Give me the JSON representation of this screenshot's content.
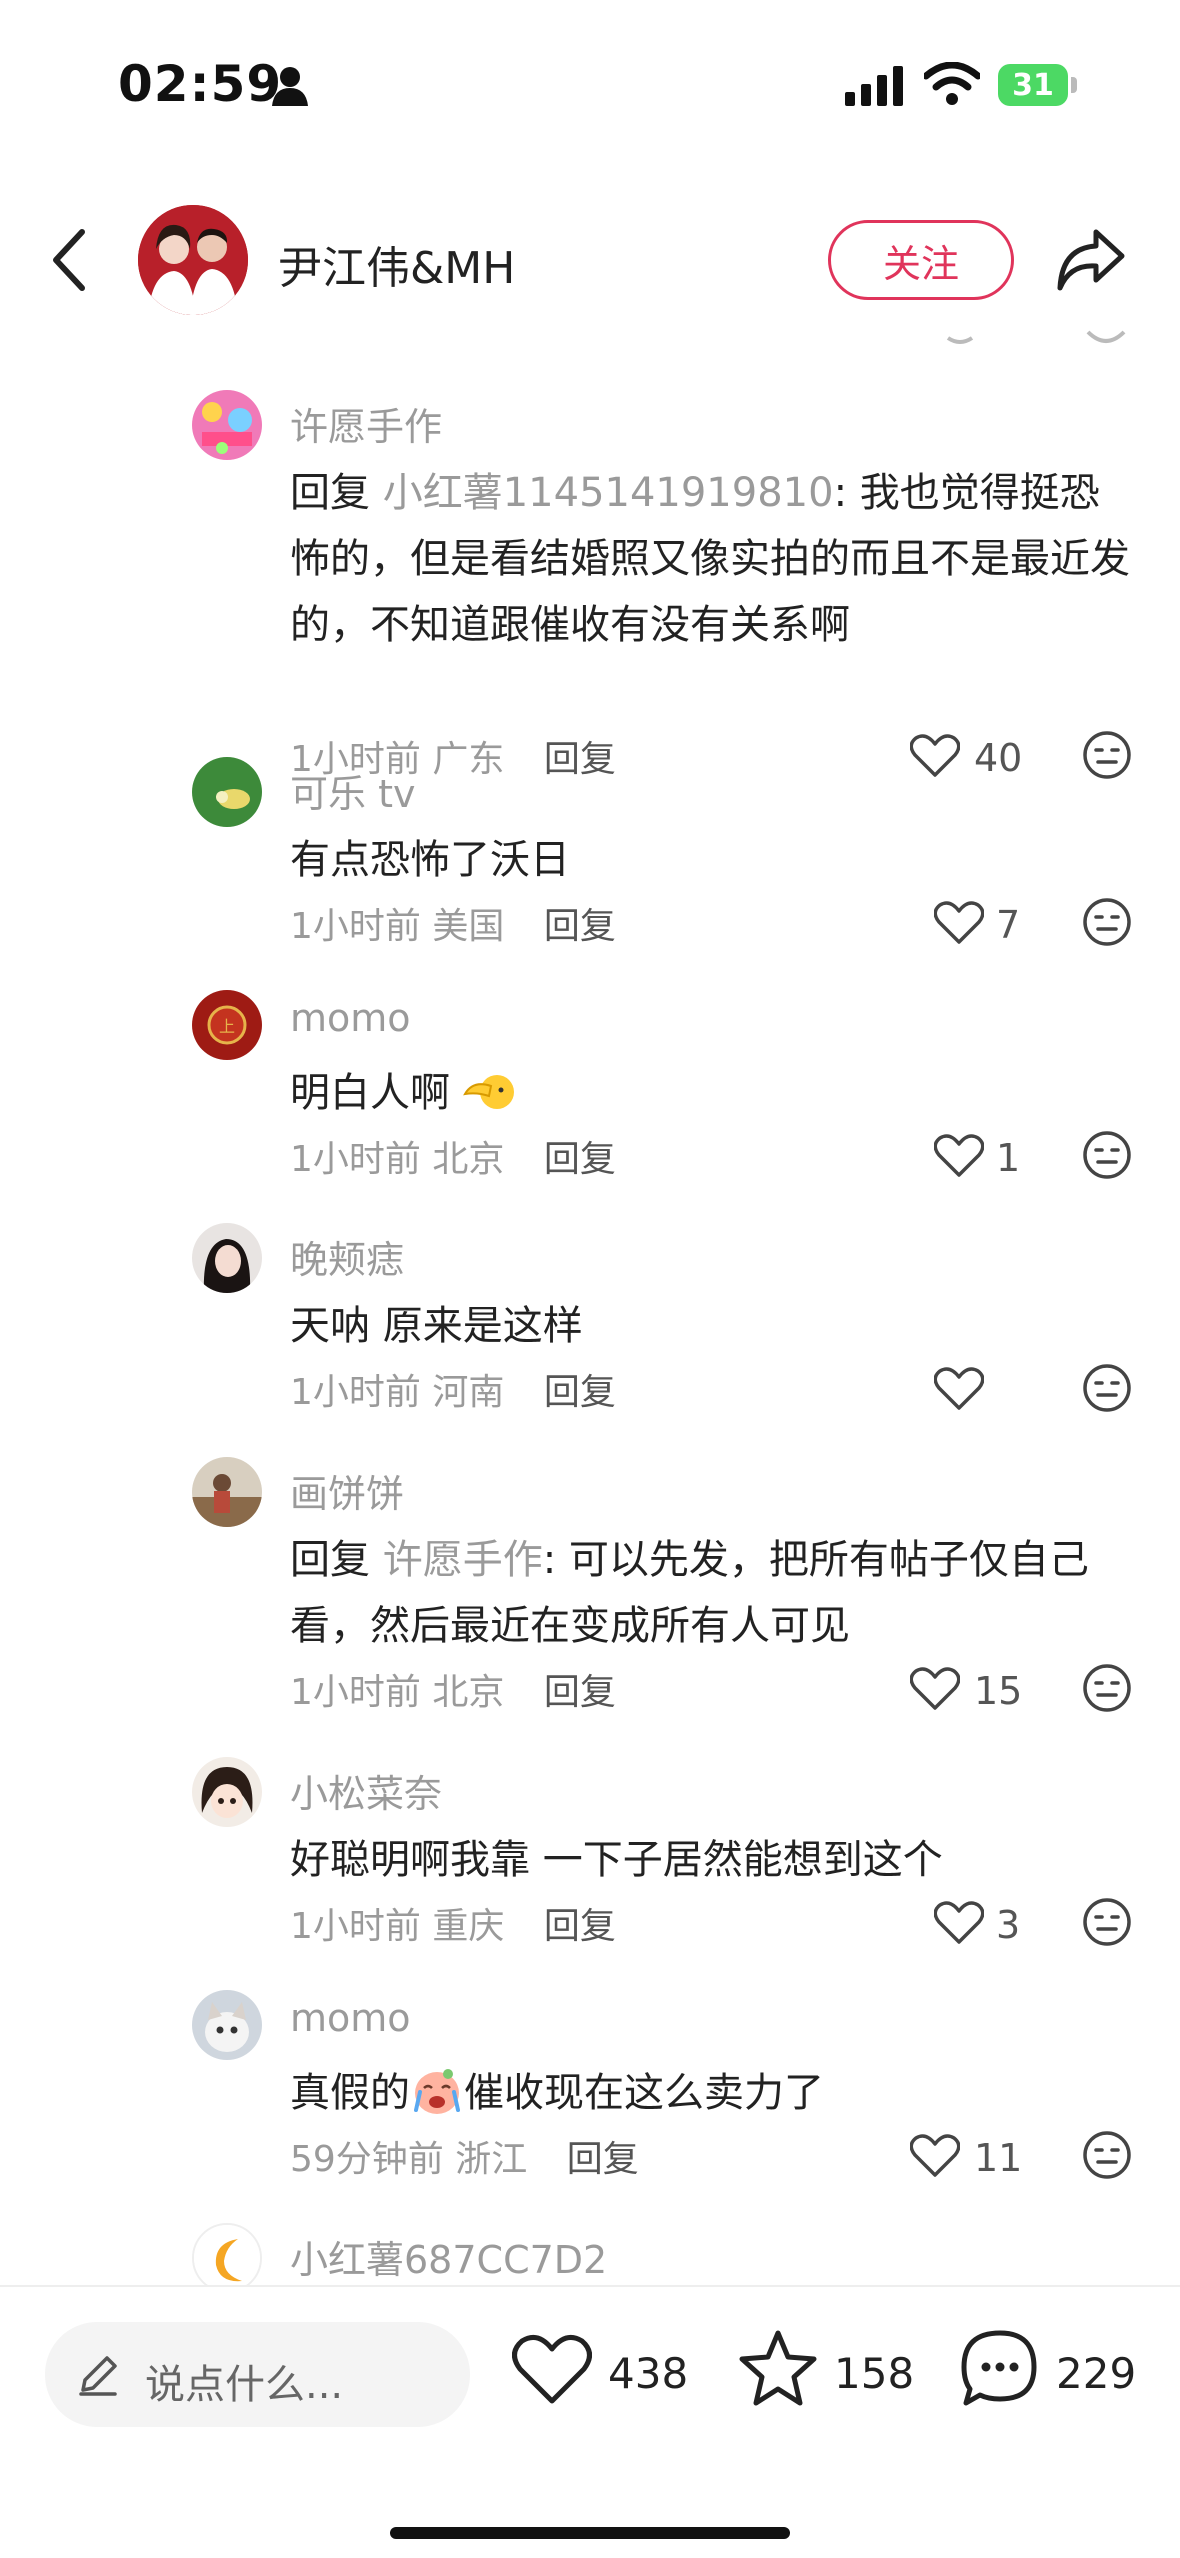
{
  "status_bar": {
    "time": "02:59",
    "battery": "31"
  },
  "header": {
    "title": "尹江伟&MH",
    "follow_label": "关注"
  },
  "comments": [
    {
      "name": "许愿手作",
      "reply_label": "回复",
      "reply_to": "小红薯1145141919810",
      "text_rest": ": 我也觉得挺恐怖的，但是看结婚照又像实拍的而且不是最近发的，不知道跟催收有没有关系啊",
      "time": "1小时前",
      "location": "广东",
      "reply_btn": "回复",
      "likes": "40"
    },
    {
      "name": "可乐 tv",
      "text": "有点恐怖了沃日",
      "time": "1小时前",
      "location": "美国",
      "reply_btn": "回复",
      "likes": "7"
    },
    {
      "name": "momo",
      "text": "明白人啊",
      "time": "1小时前",
      "location": "北京",
      "reply_btn": "回复",
      "likes": "1"
    },
    {
      "name": "晚颊痣",
      "text": "天呐 原来是这样",
      "time": "1小时前",
      "location": "河南",
      "reply_btn": "回复",
      "likes": ""
    },
    {
      "name": "画饼饼",
      "reply_label": "回复",
      "reply_to": "许愿手作",
      "text_rest": ": 可以先发，把所有帖子仅自己看，然后最近在变成所有人可见",
      "time": "1小时前",
      "location": "北京",
      "reply_btn": "回复",
      "likes": "15"
    },
    {
      "name": "小松菜奈",
      "text": "好聪明啊我靠 一下子居然能想到这个",
      "time": "1小时前",
      "location": "重庆",
      "reply_btn": "回复",
      "likes": "3"
    },
    {
      "name": "momo",
      "text_a": "真假的",
      "text_b": "催收现在这么卖力了",
      "time": "59分钟前",
      "location": "浙江",
      "reply_btn": "回复",
      "likes": "11"
    },
    {
      "name": "小红薯687CC7D2"
    }
  ],
  "bottom_bar": {
    "input_placeholder": "说点什么...",
    "likes": "438",
    "favorites": "158",
    "comments": "229"
  },
  "colors": {
    "accent": "#e0345b",
    "muted": "#9a9a9a",
    "battery": "#4cd964"
  }
}
